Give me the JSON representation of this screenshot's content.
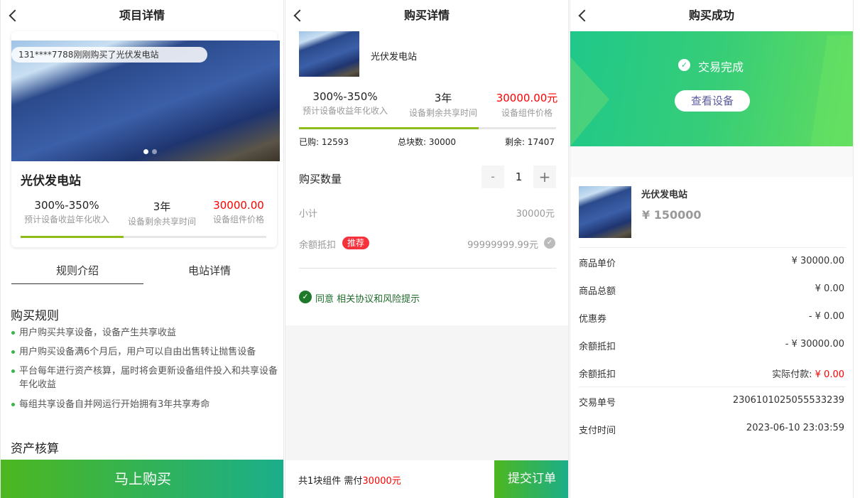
{
  "panel1": {
    "title": "项目详情",
    "toast": "131****7788刚刚购买了光伏发电站",
    "product_name": "光伏发电站",
    "stats": [
      {
        "value": "300%-350%",
        "label": "预计设备收益年化收入"
      },
      {
        "value": "3年",
        "label": "设备剩余共享时间"
      },
      {
        "value": "30000.00",
        "label": "设备组件价格"
      }
    ],
    "progress": 0.42,
    "tabs": [
      "规则介绍",
      "电站详情"
    ],
    "rules_title": "购买规则",
    "rules": [
      "用户购买共享设备，设备产生共享收益",
      "用户购买设备满6个月后，用户可以自由出售转让抛售设备",
      "平台每年进行资产核算，届时将会更新设备组件投入和共享设备年化收益",
      "每组共享设备自并网运行开始拥有3年共享寿命"
    ],
    "asset_title": "资产核算",
    "buy_button": "马上购买"
  },
  "panel2": {
    "title": "购买详情",
    "product_name": "光伏发电站",
    "stats": [
      {
        "value": "300%-350%",
        "label": "预计设备收益年化收入"
      },
      {
        "value": "3年",
        "label": "设备剩余共享时间"
      },
      {
        "value": "30000.00元",
        "label": "设备组件价格"
      }
    ],
    "progress": 0.7,
    "bought": "已购: 12593",
    "total": "总块数: 30000",
    "remaining": "剩余: 17407",
    "quantity_label": "购买数量",
    "minus": "-",
    "quantity": "1",
    "plus": "+",
    "subtotal_label": "小计",
    "subtotal": "30000元",
    "balance_label": "余额抵扣",
    "recommend_badge": "推荐",
    "balance": "99999999.99元",
    "agree_prefix": "同意",
    "agree_link": "相关协议和风险提示",
    "footer_prefix": "共1块组件 需付",
    "footer_amount": "30000元",
    "submit": "提交订单"
  },
  "panel3": {
    "title": "购买成功",
    "status": "交易完成",
    "view_button": "查看设备",
    "product_name": "光伏发电站",
    "product_price": "¥ 150000",
    "rows": [
      {
        "label": "商品单价",
        "value": "¥ 30000.00"
      },
      {
        "label": "商品总额",
        "value": "¥ 0.00"
      },
      {
        "label": "优惠券",
        "value": "- ¥ 0.00"
      },
      {
        "label": "余额抵扣",
        "value": "- ¥ 30000.00"
      },
      {
        "label": "余额抵扣",
        "value_prefix": "实际付款: ",
        "value": "¥ 0.00"
      },
      {
        "label": "交易单号",
        "value": "2306101025055533239"
      },
      {
        "label": "支付时间",
        "value": "2023-06-10 23:03:59"
      }
    ]
  },
  "colors": {
    "green": "#3ab54a",
    "red": "#f00",
    "progress": "#8cbb1a",
    "accent_badge": "#f5323c"
  }
}
